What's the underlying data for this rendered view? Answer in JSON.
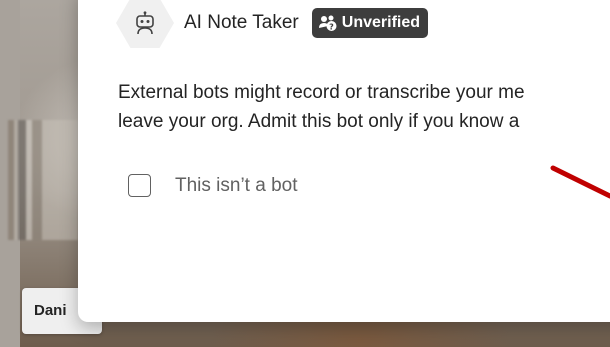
{
  "background": {
    "participant_name_partial": "Dani"
  },
  "dialog": {
    "bot_icon": "robot-icon",
    "bot_name": "AI Note Taker",
    "badge_icon": "unverified-people-icon",
    "badge_label": "Unverified",
    "warning_line1": "External bots might record or transcribe your me",
    "warning_line2": "leave your org. Admit this bot only if you know a",
    "checkbox_label": "This isn’t a bot",
    "checkbox_checked": false
  },
  "annotation": {
    "arrow_color": "#c00000"
  },
  "colors": {
    "badge_bg": "#3d3d3d",
    "text_primary": "#242424",
    "text_secondary": "#616161"
  }
}
